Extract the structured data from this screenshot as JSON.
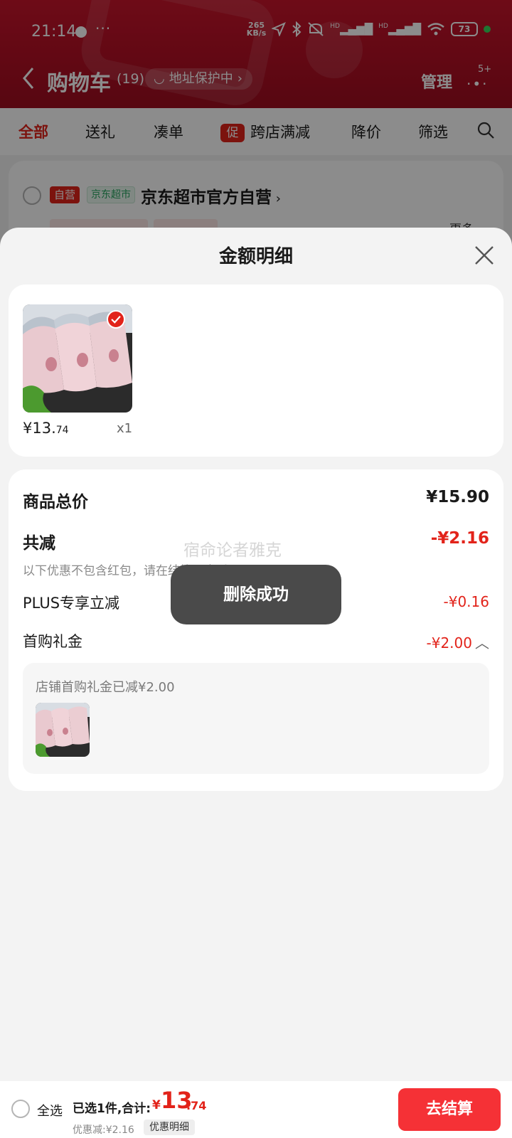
{
  "status_bar": {
    "time": "21:14",
    "more": "···",
    "speed_value": "265",
    "speed_unit": "KB/s",
    "signal1": "HD",
    "signal2": "HD",
    "battery": "73"
  },
  "nav": {
    "title": "购物车",
    "count": "(19)",
    "address": "地址保护中",
    "manage": "管理",
    "notification_badge": "5+"
  },
  "tabs": [
    {
      "label": "全部",
      "active": true
    },
    {
      "label": "送礼"
    },
    {
      "label": "凑单"
    },
    {
      "label": "跨店满减",
      "badge": "促"
    },
    {
      "label": "降价"
    },
    {
      "label": "筛选"
    }
  ],
  "store": {
    "tag_self": "自营",
    "tag_jd": "京东超市",
    "name": "京东超市官方自营",
    "more": "更多"
  },
  "sheet": {
    "title": "金额明细",
    "product": {
      "price_int": "¥13.",
      "price_dec": "74",
      "qty": "x1"
    },
    "total_label": "商品总价",
    "total_value": "¥15.90",
    "discount_label": "共减",
    "discount_value": "-¥2.16",
    "discount_note": "以下优惠不包含红包，请在结算页查看",
    "plus_label": "PLUS专享立减",
    "plus_value": "-¥0.16",
    "gift_label": "首购礼金",
    "gift_value": "-¥2.00",
    "gift_detail": "店铺首购礼金已减¥2.00"
  },
  "watermark": "宿命论者雅克",
  "toast": "删除成功",
  "bottom_bar": {
    "select_all": "全选",
    "summary": "已选1件,合计:",
    "currency": "¥",
    "total_int": "13",
    "total_dec": ".74",
    "discount": "优惠减:¥2.16",
    "detail_button": "优惠明细",
    "checkout": "去结算"
  },
  "colors": {
    "brand_red": "#e2231a",
    "header_red": "#b10f24",
    "checkout": "#f53136",
    "toast": "#4a4a4a"
  }
}
